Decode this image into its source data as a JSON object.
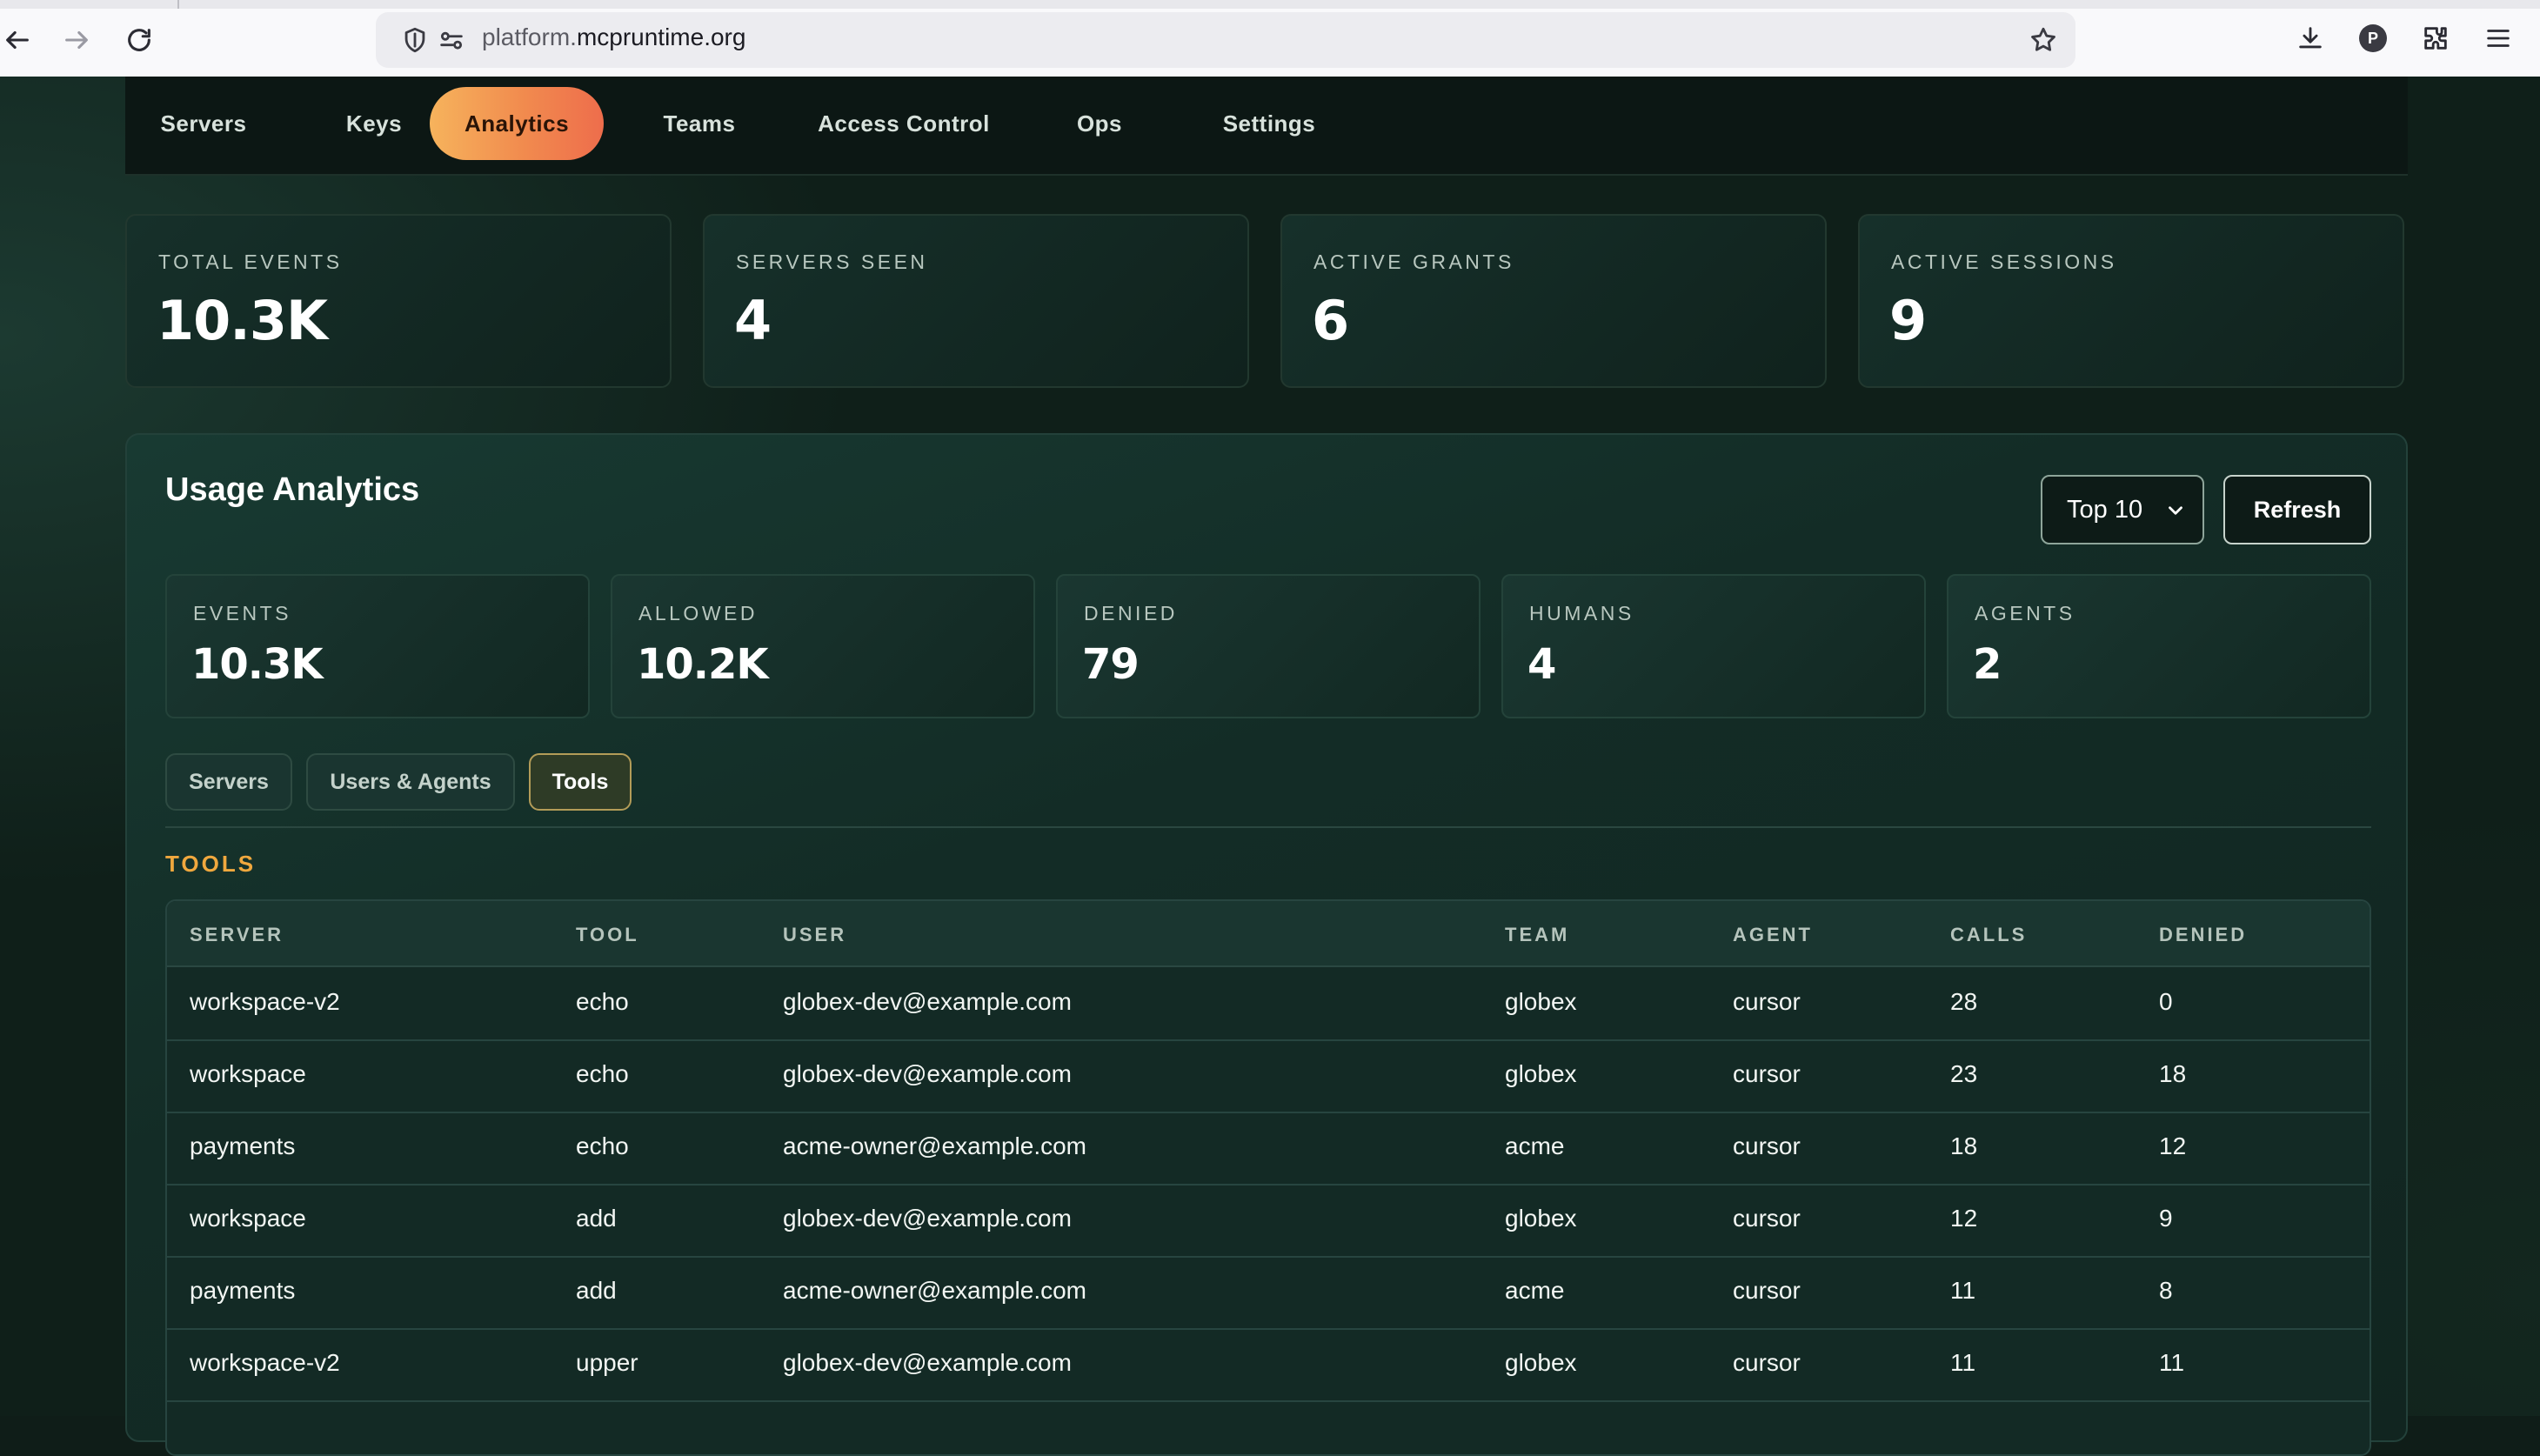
{
  "browser": {
    "url_prefix": "platform.",
    "url_host": "mcpruntime.org",
    "profile_initial": "P"
  },
  "nav": {
    "tabs": [
      {
        "label": "Servers"
      },
      {
        "label": "Keys"
      },
      {
        "label": "Analytics",
        "active": true
      },
      {
        "label": "Teams"
      },
      {
        "label": "Access Control"
      },
      {
        "label": "Ops"
      },
      {
        "label": "Settings"
      }
    ]
  },
  "stats": [
    {
      "label": "TOTAL EVENTS",
      "value": "10.3K"
    },
    {
      "label": "SERVERS SEEN",
      "value": "4"
    },
    {
      "label": "ACTIVE GRANTS",
      "value": "6"
    },
    {
      "label": "ACTIVE SESSIONS",
      "value": "9"
    }
  ],
  "analytics": {
    "title": "Usage Analytics",
    "limit_selected": "Top 10",
    "refresh_label": "Refresh",
    "metrics": [
      {
        "label": "EVENTS",
        "value": "10.3K"
      },
      {
        "label": "ALLOWED",
        "value": "10.2K"
      },
      {
        "label": "DENIED",
        "value": "79"
      },
      {
        "label": "HUMANS",
        "value": "4"
      },
      {
        "label": "AGENTS",
        "value": "2"
      }
    ],
    "subtabs": [
      {
        "label": "Servers"
      },
      {
        "label": "Users & Agents"
      },
      {
        "label": "Tools",
        "active": true
      }
    ],
    "section_title": "TOOLS",
    "table": {
      "columns": [
        "SERVER",
        "TOOL",
        "USER",
        "TEAM",
        "AGENT",
        "CALLS",
        "DENIED"
      ],
      "rows": [
        [
          "workspace-v2",
          "echo",
          "globex-dev@example.com",
          "globex",
          "cursor",
          "28",
          "0"
        ],
        [
          "workspace",
          "echo",
          "globex-dev@example.com",
          "globex",
          "cursor",
          "23",
          "18"
        ],
        [
          "payments",
          "echo",
          "acme-owner@example.com",
          "acme",
          "cursor",
          "18",
          "12"
        ],
        [
          "workspace",
          "add",
          "globex-dev@example.com",
          "globex",
          "cursor",
          "12",
          "9"
        ],
        [
          "payments",
          "add",
          "acme-owner@example.com",
          "acme",
          "cursor",
          "11",
          "8"
        ],
        [
          "workspace-v2",
          "upper",
          "globex-dev@example.com",
          "globex",
          "cursor",
          "11",
          "11"
        ]
      ]
    }
  },
  "colors": {
    "accent_gradient_start": "#f6b35c",
    "accent_gradient_end": "#ee6d4c",
    "section_title": "#f0a83e",
    "background": "#0f1f19"
  }
}
